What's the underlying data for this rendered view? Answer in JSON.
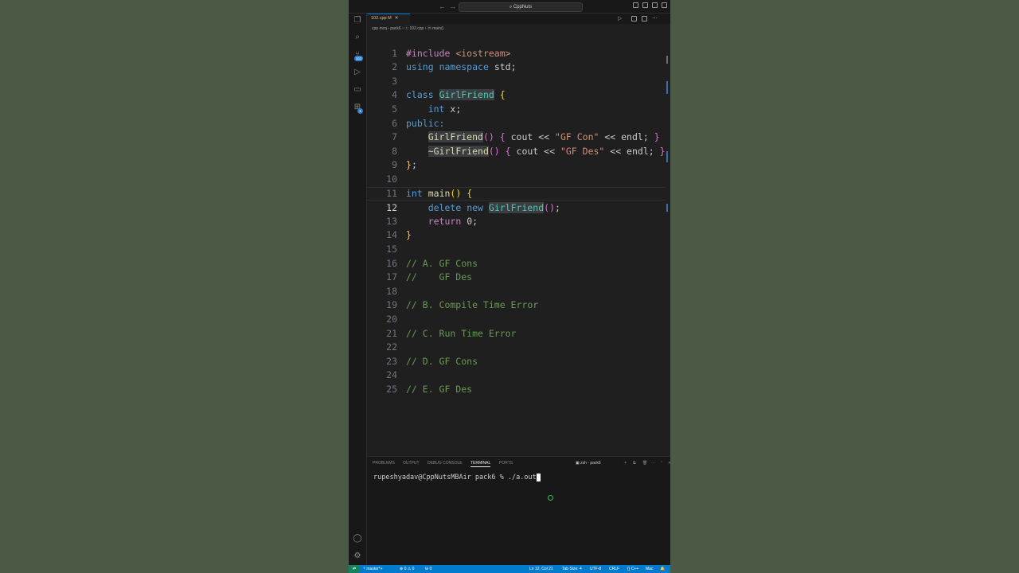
{
  "titlebar": {
    "search_text": "⌕ CppNuts",
    "back": "←",
    "forward": "→"
  },
  "tab": {
    "label": "102.cpp M",
    "close": "✕",
    "icon": "c++-file-icon"
  },
  "breadcrumb": "cpp mcq  ›  pack6  ›  ⓒ 102.cpp  ›  ⓜ main()",
  "activity": {
    "scm_badge": "163",
    "ext_badge": "1"
  },
  "editor": {
    "lines": [
      {
        "n": "1"
      },
      {
        "n": "2"
      },
      {
        "n": "3"
      },
      {
        "n": "4"
      },
      {
        "n": "5"
      },
      {
        "n": "6"
      },
      {
        "n": "7"
      },
      {
        "n": "8"
      },
      {
        "n": "9"
      },
      {
        "n": "10"
      },
      {
        "n": "11"
      },
      {
        "n": "12"
      },
      {
        "n": "13"
      },
      {
        "n": "14"
      },
      {
        "n": "15"
      },
      {
        "n": "16"
      },
      {
        "n": "17"
      },
      {
        "n": "18"
      },
      {
        "n": "19"
      },
      {
        "n": "20"
      },
      {
        "n": "21"
      },
      {
        "n": "22"
      },
      {
        "n": "23"
      },
      {
        "n": "24"
      },
      {
        "n": "25"
      }
    ],
    "code": {
      "l1_kw": "#include",
      "l1_inc": "<iostream>",
      "l2_kw1": "using",
      "l2_kw2": "namespace",
      "l2_rest": "std;",
      "l4_kw": "class",
      "l4_cls": "GirlFriend",
      "l4_br": "{",
      "l5_kw": "int",
      "l5_rest": "x;",
      "l6_kw": "public:",
      "l7_fn": "GirlFriend",
      "l7_p": "()",
      "l7_b1": "{",
      "l7_a": "cout <<",
      "l7_str": "\"GF Con\"",
      "l7_b": "<< endl;",
      "l7_b2": "}",
      "l8_fn": "~GirlFriend",
      "l8_p": "()",
      "l8_b1": "{",
      "l8_a": "cout <<",
      "l8_str": "\"GF Des\"",
      "l8_b": "<< endl;",
      "l8_b2": "}",
      "l9_br": "}",
      "l9_rest": ";",
      "l11_kw": "int",
      "l11_fn": "main",
      "l11_p": "()",
      "l11_br": "{",
      "l12_ctl": "delete",
      "l12_kw": "new",
      "l12_cls": "GirlFriend",
      "l12_p": "()",
      "l12_rest": ";",
      "l13_ctl": "return",
      "l13_rest": "0;",
      "l14_br": "}",
      "l16": "// A. GF Cons",
      "l17": "//    GF Des",
      "l19": "// B. Compile Time Error",
      "l21": "// C. Run Time Error",
      "l23": "// D. GF Cons",
      "l25": "// E. GF Des"
    }
  },
  "panel": {
    "tabs": [
      "PROBLEMS",
      "OUTPUT",
      "DEBUG CONSOLE",
      "TERMINAL",
      "PORTS"
    ],
    "active_tab": "TERMINAL",
    "shell_label": "zsh - pack6",
    "prompt": "rupeshyadav@CppNutsMBAir pack6 % ./a.out"
  },
  "statusbar": {
    "remote": "⇄",
    "branch": "ᛘ master*+",
    "problems": "⊗ 0 ⚠ 0",
    "ports": "⛁ 0",
    "position": "Ln 12, Col 21",
    "tab_size": "Tab Size: 4",
    "encoding": "UTF-8",
    "eol": "CRLF",
    "language": "{} C++",
    "platform": "Mac",
    "bell": "🔔"
  },
  "colors": {
    "accent": "#007acc",
    "editor_bg": "#1f1f1f",
    "desktop_bg": "#4b5a44"
  }
}
